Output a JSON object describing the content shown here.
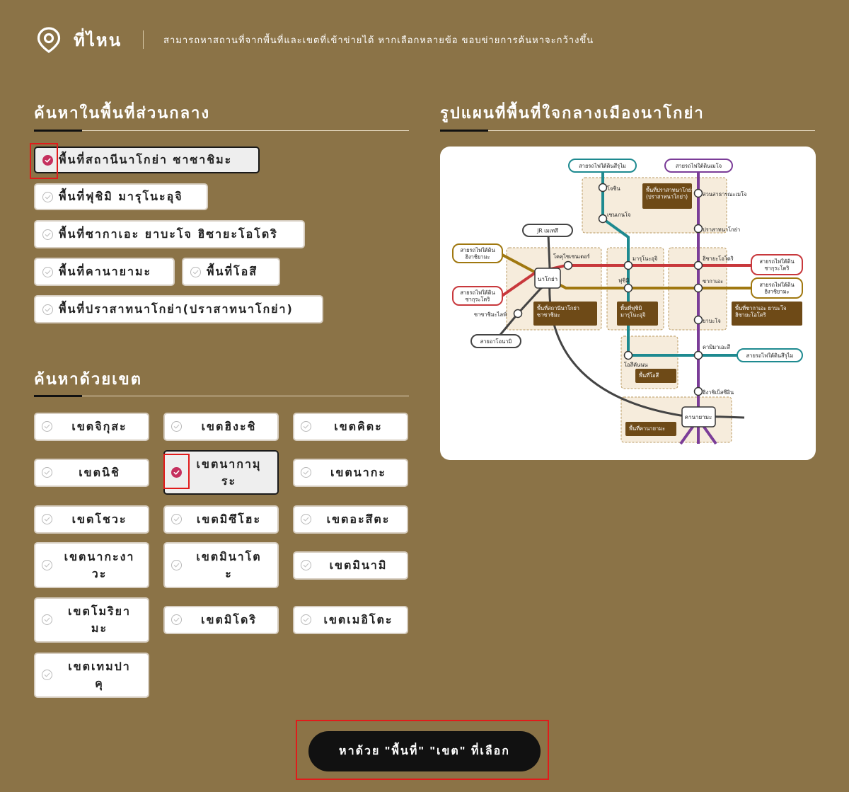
{
  "header": {
    "title": "ที่ไหน",
    "description": "สามารถหาสถานที่จากพื้นที่และเขตที่เข้าข่ายได้ หากเลือกหลายข้อ ขอบข่ายการค้นหาจะกว้างขึ้น"
  },
  "central": {
    "title": "ค้นหาในพื้นที่ส่วนกลาง",
    "areas": [
      {
        "label": "พื้นที่สถานีนาโกย่า ซาซาชิมะ",
        "checked": true
      },
      {
        "label": "พื้นที่ฟุชิมิ มารุโนะอุจิ",
        "checked": false
      },
      {
        "label": "พื้นที่ซากาเอะ ยาบะโจ ฮิซายะโอโดริ",
        "checked": false
      },
      {
        "label": "พื้นที่คานายามะ",
        "checked": false
      },
      {
        "label": "พื้นที่โอสึ",
        "checked": false
      },
      {
        "label": "พื้นที่ปราสาทนาโกย่า(ปราสาทนาโกย่า)",
        "checked": false
      }
    ]
  },
  "ward": {
    "title": "ค้นหาด้วยเขต",
    "items": [
      {
        "label": "เขตจิกุสะ",
        "checked": false
      },
      {
        "label": "เขตฮิงะชิ",
        "checked": false
      },
      {
        "label": "เขตคิตะ",
        "checked": false
      },
      {
        "label": "เขตนิชิ",
        "checked": false
      },
      {
        "label": "เขตนากามุระ",
        "checked": true
      },
      {
        "label": "เขตนากะ",
        "checked": false
      },
      {
        "label": "เขตโชวะ",
        "checked": false
      },
      {
        "label": "เขตมิซึโฮะ",
        "checked": false
      },
      {
        "label": "เขตอะสึตะ",
        "checked": false
      },
      {
        "label": "เขตนากะงาวะ",
        "checked": false
      },
      {
        "label": "เขตมินาโตะ",
        "checked": false
      },
      {
        "label": "เขตมินามิ",
        "checked": false
      },
      {
        "label": "เขตโมริยามะ",
        "checked": false
      },
      {
        "label": "เขตมิโดริ",
        "checked": false
      },
      {
        "label": "เขตเมอิโตะ",
        "checked": false
      },
      {
        "label": "เขตเทมปาคุ",
        "checked": false
      }
    ]
  },
  "map": {
    "title": "รูปแผนที่พื้นที่ใจกลางเมืองนาโกย่า",
    "lines": {
      "sakuradori_top": "สายรถไฟใต้ดินสึรุไม",
      "meijo_top": "สายรถไฟใต้ดินเมโจ",
      "jr_meitetsu": "JR เมเทสึ",
      "higashiyama_left": "สายรถไฟใต้ดิน\nฮิงาชิยามะ",
      "sakuradori_left": "สายรถไฟใต้ดิน\nซากุระโดริ",
      "sakuradori_right": "สายรถไฟใต้ดิน\nซากุระโดริ",
      "higashiyama_right": "สายรถไฟใต้ดิน\nฮิงาชิยามะ",
      "aonami": "สายอาโอนามิ",
      "tsurumai_right": "สายรถไฟใต้ดินสึรุไม"
    },
    "stations": {
      "joshin": "โจชิน",
      "sengencho": "เซนเกนโจ",
      "shiyakusho": "สวนสาธารณะเมโจ",
      "nagoyajo": "ปราสาทนาโกย่า",
      "kokusai": "โคคุไซเซนเตอร์",
      "marunouchi": "มารุโนะอุจิ",
      "hisaya": "ฮิซายะโอโดริ",
      "nagoya": "นาโกย่า",
      "fushimi": "ฟุชิมิ",
      "sakae": "ซากาเอะ",
      "sasashima": "ซาซาชิมะไลฟ์",
      "yabacho": "ยาบะโจ",
      "kamimaezu": "คามิมาเอะสึ",
      "osu": "โอสึคันนน",
      "higashibetsuin": "ฮิงาชิเบ็สซึอิน",
      "kanayama": "คานายามะ"
    },
    "areas": {
      "castle": "พื้นที่ปราสาทนาโกย่า\n(ปราสาทนาโกย่า)",
      "station": "พื้นที่สถานีนาโกย่า\nซาซาชิมะ",
      "fushimi": "พื้นที่ฟุชิมิ\nมารุโนะอุจิ",
      "sakae": "พื้นที่ซากาเอะ ยาบะโจ\nฮิซายะโอโดริ",
      "osu": "พื้นที่โอสึ",
      "kanayama": "พื้นที่คานายามะ"
    },
    "colors": {
      "tsurumai": "#1e8a90",
      "meijo": "#7b3d98",
      "higashiyama": "#a07810",
      "sakuradori": "#c8383c",
      "jr": "#444444",
      "area_fill": "#f6ecdc",
      "area_label": "#6e4a17"
    }
  },
  "search_button": {
    "label": "หาด้วย \"พื้นที่\" \"เขต\" ที่เลือก"
  },
  "colors": {
    "background": "#8b7347",
    "check_on": "#c5305e",
    "highlight": "#e01b1b"
  }
}
